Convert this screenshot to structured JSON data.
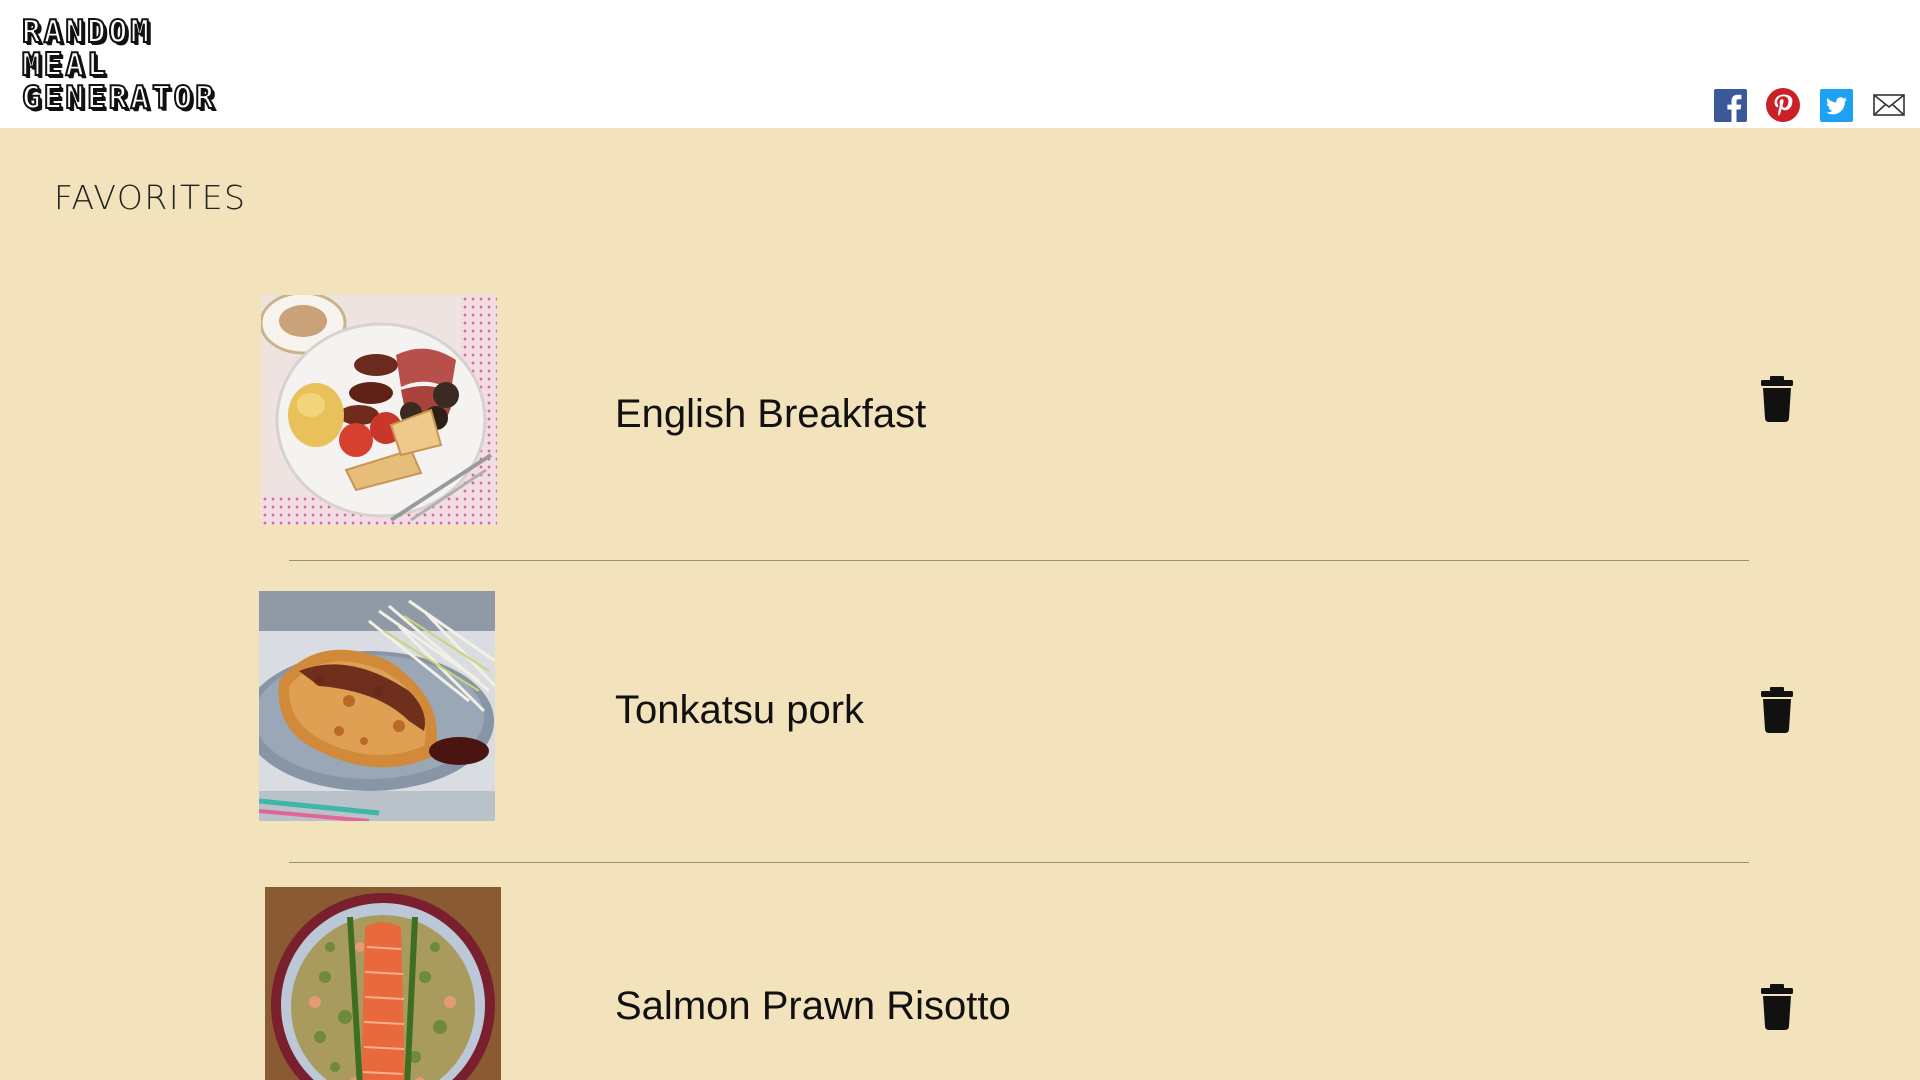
{
  "header": {
    "logo_lines": [
      "RANDOM",
      "MEAL",
      "GENERATOR"
    ],
    "social": [
      {
        "name": "facebook-icon",
        "color": "#3b5998"
      },
      {
        "name": "pinterest-icon",
        "color": "#cb2027"
      },
      {
        "name": "twitter-icon",
        "color": "#1da1f2"
      },
      {
        "name": "email-icon",
        "color": "#333333"
      }
    ]
  },
  "page": {
    "title": "FAVORITES",
    "background": "#f2e3bd"
  },
  "favorites": [
    {
      "name": "English Breakfast",
      "image": "english-breakfast-photo"
    },
    {
      "name": "Tonkatsu pork",
      "image": "tonkatsu-pork-photo"
    },
    {
      "name": "Salmon Prawn Risotto",
      "image": "salmon-prawn-risotto-photo"
    }
  ]
}
